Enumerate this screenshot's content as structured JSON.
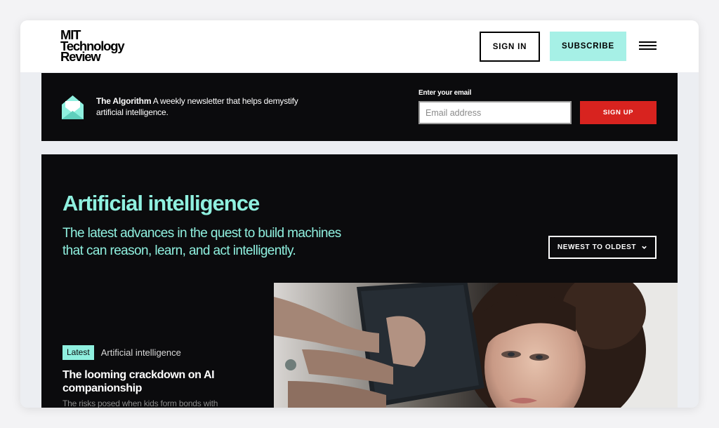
{
  "header": {
    "logo_lines": [
      "MIT",
      "Technology",
      "Review"
    ],
    "sign_in_label": "SIGN IN",
    "subscribe_label": "SUBSCRIBE",
    "icons": {
      "menu": "hamburger-menu-icon"
    },
    "colors": {
      "subscribe_bg": "#a6f0e6"
    }
  },
  "newsletter": {
    "icon": "envelope-icon",
    "name": "The Algorithm",
    "description": "A weekly newsletter that helps demystify artificial intelligence.",
    "email_label": "Enter your email",
    "email_placeholder": "Email address",
    "email_value": "",
    "signup_label": "SIGN UP",
    "colors": {
      "signup_bg": "#d8231f"
    }
  },
  "topic": {
    "title": "Artificial intelligence",
    "description": "The latest advances in the quest to build machines that can reason, learn, and act intelligently.",
    "sort_label": "NEWEST TO OLDEST",
    "sort_icon": "chevron-down-icon",
    "colors": {
      "accent": "#8ff0df",
      "background": "#0b0b0d"
    }
  },
  "featured_article": {
    "badge": "Latest",
    "topic": "Artificial intelligence",
    "title": "The looming crackdown on AI companionship",
    "dek": "The risks posed when kids form bonds with",
    "image": "photo-of-woman-holding-phone"
  }
}
